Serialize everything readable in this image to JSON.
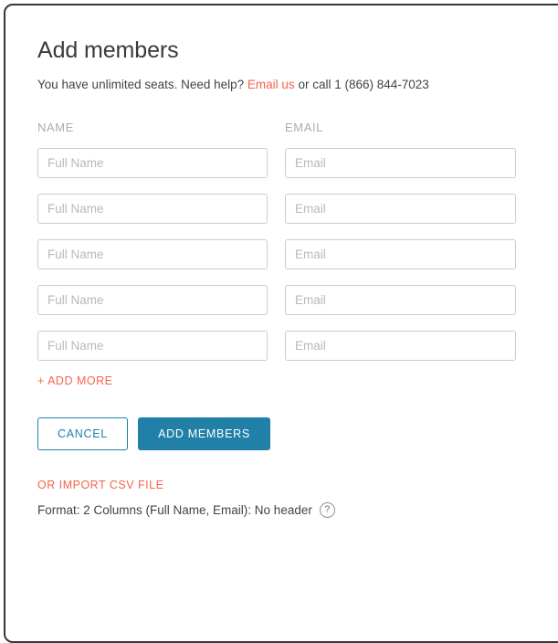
{
  "card": {
    "border_color": "#33373b"
  },
  "header": {
    "title": "Add members",
    "subtitle_before": "You have unlimited seats. Need help? ",
    "email_link": "Email us",
    "subtitle_after": " or call 1 (866) 844-7023"
  },
  "columns": {
    "name_header": "NAME",
    "email_header": "EMAIL"
  },
  "rows": [
    {
      "name_value": "",
      "name_placeholder": "Full Name",
      "email_value": "",
      "email_placeholder": "Email"
    },
    {
      "name_value": "",
      "name_placeholder": "Full Name",
      "email_value": "",
      "email_placeholder": "Email"
    },
    {
      "name_value": "",
      "name_placeholder": "Full Name",
      "email_value": "",
      "email_placeholder": "Email"
    },
    {
      "name_value": "",
      "name_placeholder": "Full Name",
      "email_value": "",
      "email_placeholder": "Email"
    },
    {
      "name_value": "",
      "name_placeholder": "Full Name",
      "email_value": "",
      "email_placeholder": "Email"
    }
  ],
  "add_more": {
    "label": "+ ADD MORE"
  },
  "actions": {
    "cancel_label": "CANCEL",
    "submit_label": "ADD MEMBERS"
  },
  "csv": {
    "import_label": "OR IMPORT CSV FILE",
    "format_text": "Format: 2 Columns (Full Name, Email): No header",
    "help_glyph": "?"
  },
  "colors": {
    "accent_coral": "#f4644b",
    "accent_blue": "#2180a8",
    "text_dark": "#3f4448",
    "text_muted": "#a9adb1",
    "field_border": "#c9cdd1"
  }
}
